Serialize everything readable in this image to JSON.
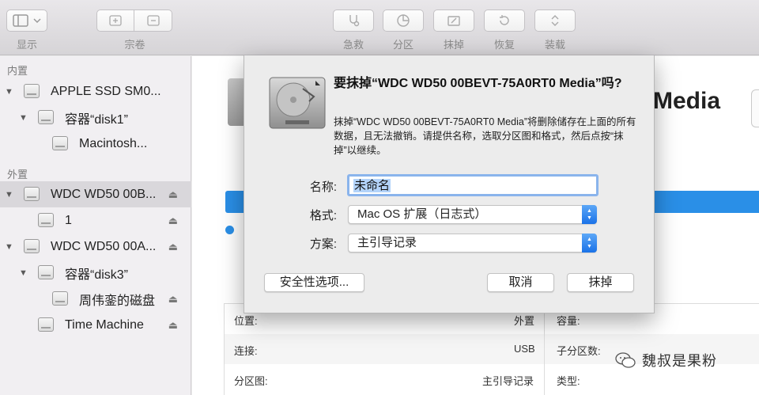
{
  "toolbar": {
    "view_label": "显示",
    "volume_label": "宗卷",
    "first_aid_label": "急救",
    "partition_label": "分区",
    "erase_label": "抹掉",
    "restore_label": "恢复",
    "mount_label": "装载"
  },
  "sidebar": {
    "internal_title": "内置",
    "external_title": "外置",
    "items": [
      {
        "label": "APPLE SSD SM0..."
      },
      {
        "label": "容器“disk1”"
      },
      {
        "label": "Macintosh..."
      },
      {
        "label": "WDC WD50 00B..."
      },
      {
        "label": "1"
      },
      {
        "label": "WDC WD50 00A..."
      },
      {
        "label": "容器“disk3”"
      },
      {
        "label": "周伟銮的磁盘"
      },
      {
        "label": "Time Machine"
      }
    ]
  },
  "main": {
    "title_partial": "Media",
    "info": {
      "location_label": "位置:",
      "location_value": "外置",
      "connection_label": "连接:",
      "connection_value": "USB",
      "partition_map_label": "分区图:",
      "partition_map_value": "主引导记录",
      "capacity_label": "容量:",
      "child_count_label": "子分区数:",
      "type_label": "类型:"
    }
  },
  "dialog": {
    "title": "要抹掉“WDC WD50 00BEVT-75A0RT0 Media”吗?",
    "message": "抹掉“WDC WD50 00BEVT-75A0RT0 Media”将删除储存在上面的所有数据，且无法撤销。请提供名称，选取分区图和格式，然后点按“抹掉”以继续。",
    "name_label": "名称:",
    "name_value": "未命名",
    "format_label": "格式:",
    "format_value": "Mac OS 扩展（日志式）",
    "scheme_label": "方案:",
    "scheme_value": "主引导记录",
    "security_button": "安全性选项...",
    "cancel_button": "取消",
    "erase_button": "抹掉"
  },
  "watermark": {
    "text": "魏叔是果粉"
  }
}
